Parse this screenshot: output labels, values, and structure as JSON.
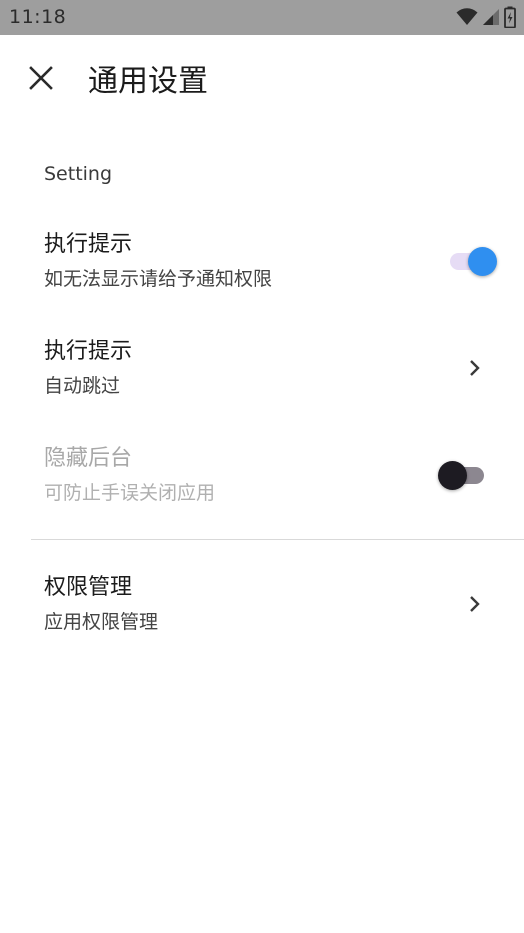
{
  "status_bar": {
    "time": "11:18",
    "icons": [
      "wifi-icon",
      "cell-signal-icon",
      "battery-charging-icon"
    ]
  },
  "app_bar": {
    "close_icon": "close-icon",
    "title": "通用设置"
  },
  "section": {
    "header": "Setting"
  },
  "settings": [
    {
      "title": "执行提示",
      "subtitle": "如无法显示请给予通知权限",
      "control": "switch",
      "checked": true,
      "enabled": true
    },
    {
      "title": "执行提示",
      "subtitle": "自动跳过",
      "control": "chevron-right-icon",
      "enabled": true
    },
    {
      "title": "隐藏后台",
      "subtitle": "可防止手误关闭应用",
      "control": "switch",
      "checked": false,
      "enabled": false
    }
  ],
  "permissions": {
    "title": "权限管理",
    "subtitle": "应用权限管理",
    "control": "chevron-right-icon"
  },
  "colors": {
    "status_bar": "#9e9e9e",
    "switch_on_thumb": "#2f8ff0",
    "switch_on_track": "#e6dcf5",
    "switch_off_thumb": "#1d1b22",
    "switch_off_track": "#8c8790",
    "divider": "#d9d9d9"
  }
}
